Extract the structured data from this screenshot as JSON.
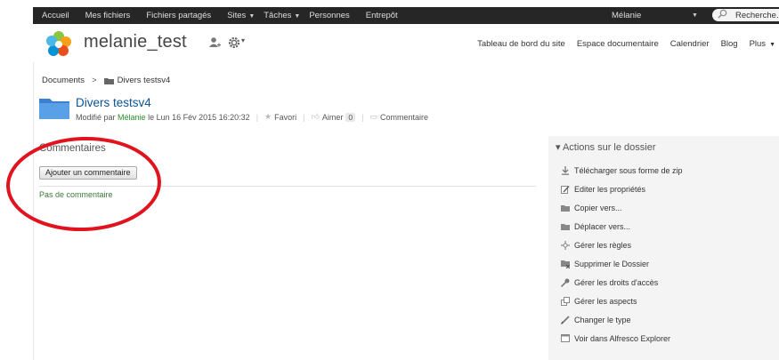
{
  "topbar": {
    "nav": [
      "Accueil",
      "Mes fichiers",
      "Fichiers partagés",
      "Sites",
      "Tâches",
      "Personnes",
      "Entrepôt"
    ],
    "user": "Mélanie",
    "search_placeholder": "Recherche..."
  },
  "site": {
    "title": "melanie_test",
    "nav": [
      "Tableau de bord du site",
      "Espace documentaire",
      "Calendrier",
      "Blog",
      "Plus"
    ]
  },
  "breadcrumb": {
    "root": "Documents",
    "separator": ">",
    "current": "Divers testsv4"
  },
  "folder": {
    "name": "Divers testsv4",
    "modified_prefix": "Modifié par",
    "modified_by": "Mélanie",
    "modified_date": "le Lun 16 Fév 2015 16:20:32",
    "favorite": "Favori",
    "like": "Aimer",
    "like_count": "0",
    "comment": "Commentaire"
  },
  "comments": {
    "title": "Commentaires",
    "add_button": "Ajouter un commentaire",
    "empty": "Pas de commentaire"
  },
  "actions": {
    "title": "▾ Actions sur le dossier",
    "items": [
      {
        "label": "Télécharger sous forme de zip",
        "icon": "download-icon"
      },
      {
        "label": "Editer les propriétés",
        "icon": "edit-icon"
      },
      {
        "label": "Copier vers...",
        "icon": "copy-folder-icon"
      },
      {
        "label": "Déplacer vers...",
        "icon": "move-folder-icon"
      },
      {
        "label": "Gérer les règles",
        "icon": "rules-icon"
      },
      {
        "label": "Supprimer le Dossier",
        "icon": "delete-folder-icon"
      },
      {
        "label": "Gérer les droits d'accès",
        "icon": "permissions-icon"
      },
      {
        "label": "Gérer les aspects",
        "icon": "aspects-icon"
      },
      {
        "label": "Changer le type",
        "icon": "change-type-icon"
      },
      {
        "label": "Voir dans Alfresco Explorer",
        "icon": "explorer-icon"
      }
    ]
  },
  "colors": {
    "topbar_bg": "#262626",
    "folder_blue": "#4a90d9",
    "link_green": "#2d8f2d",
    "annotation_red": "#e0141e"
  }
}
